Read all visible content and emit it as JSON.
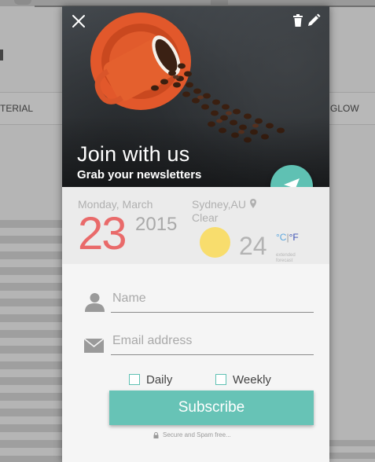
{
  "background": {
    "menu_left": "TERIAL",
    "menu_right": "GLOW"
  },
  "card": {
    "title": "Join with us",
    "subtitle": "Grab your newsletters",
    "icons": {
      "close": "close-icon",
      "trash": "trash-icon",
      "edit": "pencil-icon",
      "send": "send-icon"
    },
    "accent_color": "#5fc1b3"
  },
  "info": {
    "date_label": "Monday, March",
    "day": "23",
    "year": "2015",
    "location": "Sydney,AU",
    "condition": "Clear",
    "temperature": "24",
    "unit_c": "°C",
    "unit_sep": "|",
    "unit_f": "°F",
    "extended": "extended forecast"
  },
  "form": {
    "name_placeholder": "Name",
    "email_placeholder": "Email address",
    "daily_label": "Daily",
    "weekly_label": "Weekly",
    "subscribe_label": "Subscribe",
    "secure_text": "Secure and Spam free..."
  }
}
